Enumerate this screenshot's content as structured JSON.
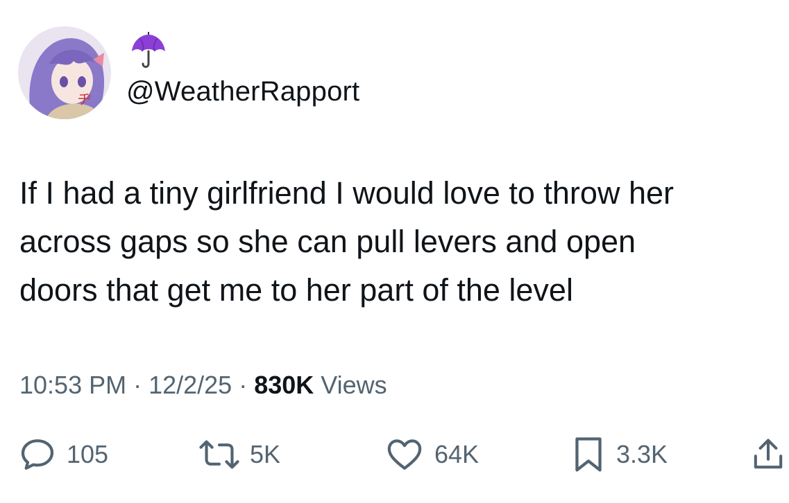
{
  "author": {
    "display_name_icon": "umbrella-icon",
    "handle": "@WeatherRapport",
    "avatar_alt": "anime-character-avatar"
  },
  "tweet": {
    "lines": [
      "If I had a tiny girlfriend I would love to throw her",
      "across gaps so she can pull levers and open",
      "doors that get me to her part of the level"
    ]
  },
  "meta": {
    "time": "10:53 PM",
    "separator": " · ",
    "date": "12/2/25",
    "views_count": "830K",
    "views_label": " Views"
  },
  "actions": {
    "reply": {
      "icon": "reply-icon",
      "count": "105"
    },
    "retweet": {
      "icon": "retweet-icon",
      "count": "5K"
    },
    "like": {
      "icon": "heart-icon",
      "count": "64K"
    },
    "bookmark": {
      "icon": "bookmark-icon",
      "count": "3.3K"
    },
    "share": {
      "icon": "share-icon"
    }
  },
  "colors": {
    "text": "#0f1419",
    "secondary": "#536471",
    "umbrella": "#8b3fd6"
  }
}
